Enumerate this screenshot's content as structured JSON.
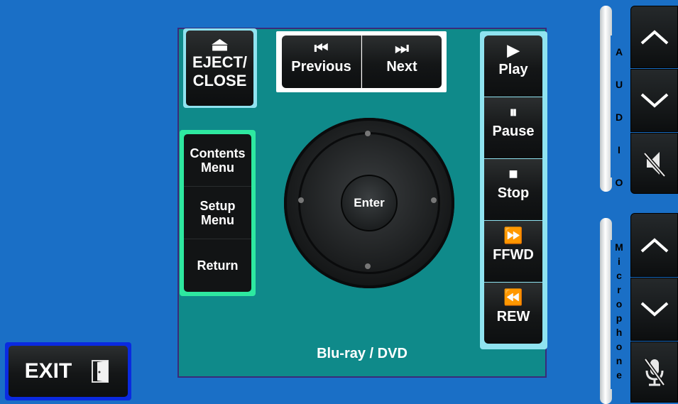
{
  "panel": {
    "device_label": "Blu-ray / DVD"
  },
  "eject": {
    "icon": "eject-icon",
    "glyph": "⏏",
    "label_line1": "EJECT/",
    "label_line2": "CLOSE"
  },
  "previous": {
    "icon": "skip-previous-icon",
    "glyph": "⏮",
    "label": "Previous"
  },
  "next": {
    "icon": "skip-next-icon",
    "glyph": "⏭",
    "label": "Next"
  },
  "menu": {
    "contents_line1": "Contents",
    "contents_line2": "Menu",
    "setup_line1": "Setup",
    "setup_line2": "Menu",
    "return": "Return"
  },
  "dpad": {
    "enter_label": "Enter"
  },
  "transport": {
    "play": {
      "icon": "play-icon",
      "glyph": "▶",
      "label": "Play"
    },
    "pause": {
      "icon": "pause-icon",
      "glyph": "⏸",
      "label": "Pause"
    },
    "stop": {
      "icon": "stop-icon",
      "glyph": "■",
      "label": "Stop"
    },
    "ffwd": {
      "icon": "fast-forward-icon",
      "glyph": "⏩",
      "label": "FFWD"
    },
    "rew": {
      "icon": "rewind-icon",
      "glyph": "⏪",
      "label": "REW"
    }
  },
  "exit": {
    "label": "EXIT",
    "icon": "door-exit-icon"
  },
  "audio": {
    "label": "AUDIO",
    "letters": [
      "A",
      "U",
      "D",
      "I",
      "O"
    ]
  },
  "microphone": {
    "label": "Microphone",
    "letters": [
      "M",
      "i",
      "c",
      "r",
      "o",
      "p",
      "h",
      "o",
      "n",
      "e"
    ]
  },
  "colors": {
    "background": "#1a6fc6",
    "panel": "#0f8a8a",
    "menu_border": "#2ee8a0",
    "transport_border": "#8fe3f0",
    "exit_border": "#0a2ae0"
  }
}
